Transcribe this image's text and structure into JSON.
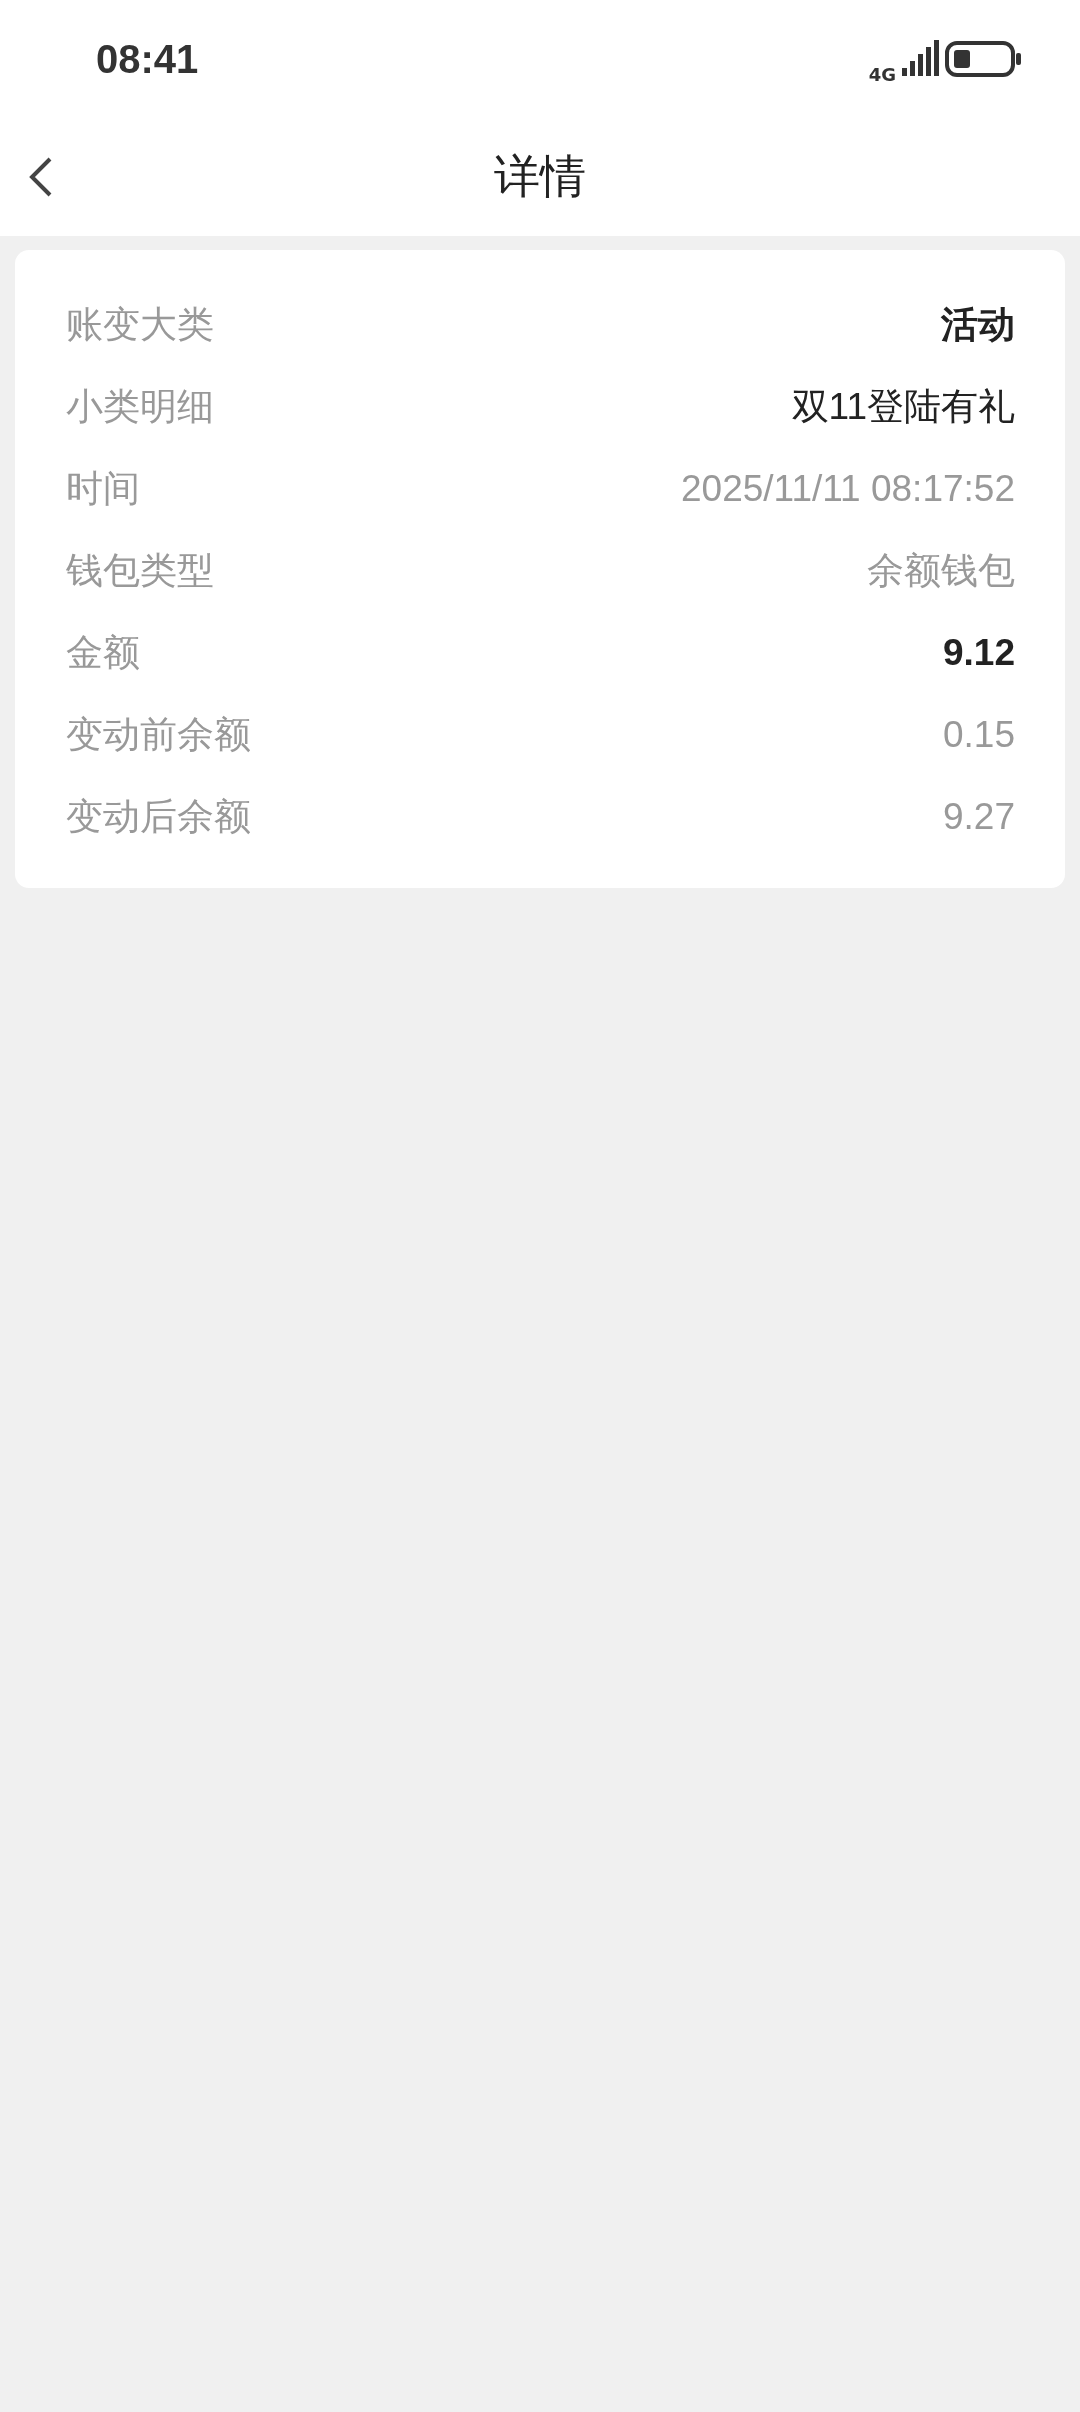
{
  "status_bar": {
    "time": "08:41",
    "network": "4G"
  },
  "nav": {
    "title": "详情"
  },
  "details": [
    {
      "label": "账变大类",
      "value": "活动",
      "kind": "strong"
    },
    {
      "label": "小类明细",
      "value": "双11登陆有礼",
      "kind": "normal"
    },
    {
      "label": "时间",
      "value": "2025/11/11 08:17:52",
      "kind": "muted"
    },
    {
      "label": "钱包类型",
      "value": "余额钱包",
      "kind": "muted"
    },
    {
      "label": "金额",
      "value": "9.12",
      "kind": "strong"
    },
    {
      "label": "变动前余额",
      "value": "0.15",
      "kind": "muted"
    },
    {
      "label": "变动后余额",
      "value": "9.27",
      "kind": "muted"
    }
  ]
}
